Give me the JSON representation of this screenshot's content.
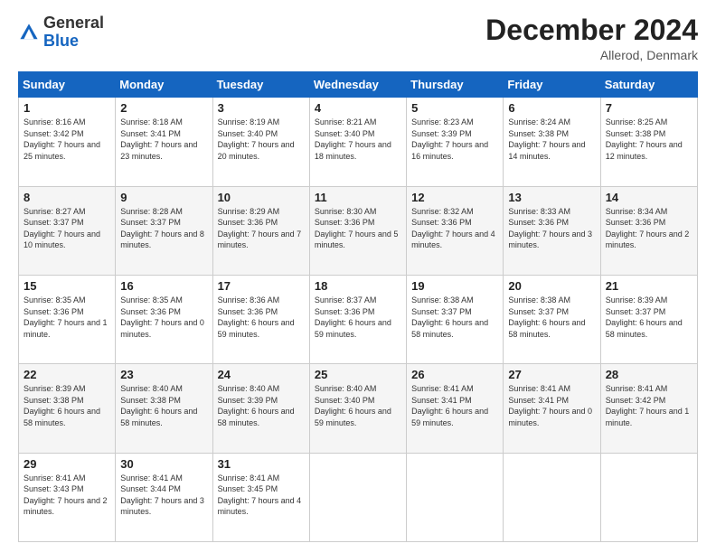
{
  "header": {
    "logo_general": "General",
    "logo_blue": "Blue",
    "month_title": "December 2024",
    "subtitle": "Allerod, Denmark"
  },
  "days_of_week": [
    "Sunday",
    "Monday",
    "Tuesday",
    "Wednesday",
    "Thursday",
    "Friday",
    "Saturday"
  ],
  "weeks": [
    [
      {
        "day": "1",
        "sunrise": "Sunrise: 8:16 AM",
        "sunset": "Sunset: 3:42 PM",
        "daylight": "Daylight: 7 hours and 25 minutes."
      },
      {
        "day": "2",
        "sunrise": "Sunrise: 8:18 AM",
        "sunset": "Sunset: 3:41 PM",
        "daylight": "Daylight: 7 hours and 23 minutes."
      },
      {
        "day": "3",
        "sunrise": "Sunrise: 8:19 AM",
        "sunset": "Sunset: 3:40 PM",
        "daylight": "Daylight: 7 hours and 20 minutes."
      },
      {
        "day": "4",
        "sunrise": "Sunrise: 8:21 AM",
        "sunset": "Sunset: 3:40 PM",
        "daylight": "Daylight: 7 hours and 18 minutes."
      },
      {
        "day": "5",
        "sunrise": "Sunrise: 8:23 AM",
        "sunset": "Sunset: 3:39 PM",
        "daylight": "Daylight: 7 hours and 16 minutes."
      },
      {
        "day": "6",
        "sunrise": "Sunrise: 8:24 AM",
        "sunset": "Sunset: 3:38 PM",
        "daylight": "Daylight: 7 hours and 14 minutes."
      },
      {
        "day": "7",
        "sunrise": "Sunrise: 8:25 AM",
        "sunset": "Sunset: 3:38 PM",
        "daylight": "Daylight: 7 hours and 12 minutes."
      }
    ],
    [
      {
        "day": "8",
        "sunrise": "Sunrise: 8:27 AM",
        "sunset": "Sunset: 3:37 PM",
        "daylight": "Daylight: 7 hours and 10 minutes."
      },
      {
        "day": "9",
        "sunrise": "Sunrise: 8:28 AM",
        "sunset": "Sunset: 3:37 PM",
        "daylight": "Daylight: 7 hours and 8 minutes."
      },
      {
        "day": "10",
        "sunrise": "Sunrise: 8:29 AM",
        "sunset": "Sunset: 3:36 PM",
        "daylight": "Daylight: 7 hours and 7 minutes."
      },
      {
        "day": "11",
        "sunrise": "Sunrise: 8:30 AM",
        "sunset": "Sunset: 3:36 PM",
        "daylight": "Daylight: 7 hours and 5 minutes."
      },
      {
        "day": "12",
        "sunrise": "Sunrise: 8:32 AM",
        "sunset": "Sunset: 3:36 PM",
        "daylight": "Daylight: 7 hours and 4 minutes."
      },
      {
        "day": "13",
        "sunrise": "Sunrise: 8:33 AM",
        "sunset": "Sunset: 3:36 PM",
        "daylight": "Daylight: 7 hours and 3 minutes."
      },
      {
        "day": "14",
        "sunrise": "Sunrise: 8:34 AM",
        "sunset": "Sunset: 3:36 PM",
        "daylight": "Daylight: 7 hours and 2 minutes."
      }
    ],
    [
      {
        "day": "15",
        "sunrise": "Sunrise: 8:35 AM",
        "sunset": "Sunset: 3:36 PM",
        "daylight": "Daylight: 7 hours and 1 minute."
      },
      {
        "day": "16",
        "sunrise": "Sunrise: 8:35 AM",
        "sunset": "Sunset: 3:36 PM",
        "daylight": "Daylight: 7 hours and 0 minutes."
      },
      {
        "day": "17",
        "sunrise": "Sunrise: 8:36 AM",
        "sunset": "Sunset: 3:36 PM",
        "daylight": "Daylight: 6 hours and 59 minutes."
      },
      {
        "day": "18",
        "sunrise": "Sunrise: 8:37 AM",
        "sunset": "Sunset: 3:36 PM",
        "daylight": "Daylight: 6 hours and 59 minutes."
      },
      {
        "day": "19",
        "sunrise": "Sunrise: 8:38 AM",
        "sunset": "Sunset: 3:37 PM",
        "daylight": "Daylight: 6 hours and 58 minutes."
      },
      {
        "day": "20",
        "sunrise": "Sunrise: 8:38 AM",
        "sunset": "Sunset: 3:37 PM",
        "daylight": "Daylight: 6 hours and 58 minutes."
      },
      {
        "day": "21",
        "sunrise": "Sunrise: 8:39 AM",
        "sunset": "Sunset: 3:37 PM",
        "daylight": "Daylight: 6 hours and 58 minutes."
      }
    ],
    [
      {
        "day": "22",
        "sunrise": "Sunrise: 8:39 AM",
        "sunset": "Sunset: 3:38 PM",
        "daylight": "Daylight: 6 hours and 58 minutes."
      },
      {
        "day": "23",
        "sunrise": "Sunrise: 8:40 AM",
        "sunset": "Sunset: 3:38 PM",
        "daylight": "Daylight: 6 hours and 58 minutes."
      },
      {
        "day": "24",
        "sunrise": "Sunrise: 8:40 AM",
        "sunset": "Sunset: 3:39 PM",
        "daylight": "Daylight: 6 hours and 58 minutes."
      },
      {
        "day": "25",
        "sunrise": "Sunrise: 8:40 AM",
        "sunset": "Sunset: 3:40 PM",
        "daylight": "Daylight: 6 hours and 59 minutes."
      },
      {
        "day": "26",
        "sunrise": "Sunrise: 8:41 AM",
        "sunset": "Sunset: 3:41 PM",
        "daylight": "Daylight: 6 hours and 59 minutes."
      },
      {
        "day": "27",
        "sunrise": "Sunrise: 8:41 AM",
        "sunset": "Sunset: 3:41 PM",
        "daylight": "Daylight: 7 hours and 0 minutes."
      },
      {
        "day": "28",
        "sunrise": "Sunrise: 8:41 AM",
        "sunset": "Sunset: 3:42 PM",
        "daylight": "Daylight: 7 hours and 1 minute."
      }
    ],
    [
      {
        "day": "29",
        "sunrise": "Sunrise: 8:41 AM",
        "sunset": "Sunset: 3:43 PM",
        "daylight": "Daylight: 7 hours and 2 minutes."
      },
      {
        "day": "30",
        "sunrise": "Sunrise: 8:41 AM",
        "sunset": "Sunset: 3:44 PM",
        "daylight": "Daylight: 7 hours and 3 minutes."
      },
      {
        "day": "31",
        "sunrise": "Sunrise: 8:41 AM",
        "sunset": "Sunset: 3:45 PM",
        "daylight": "Daylight: 7 hours and 4 minutes."
      },
      null,
      null,
      null,
      null
    ]
  ]
}
